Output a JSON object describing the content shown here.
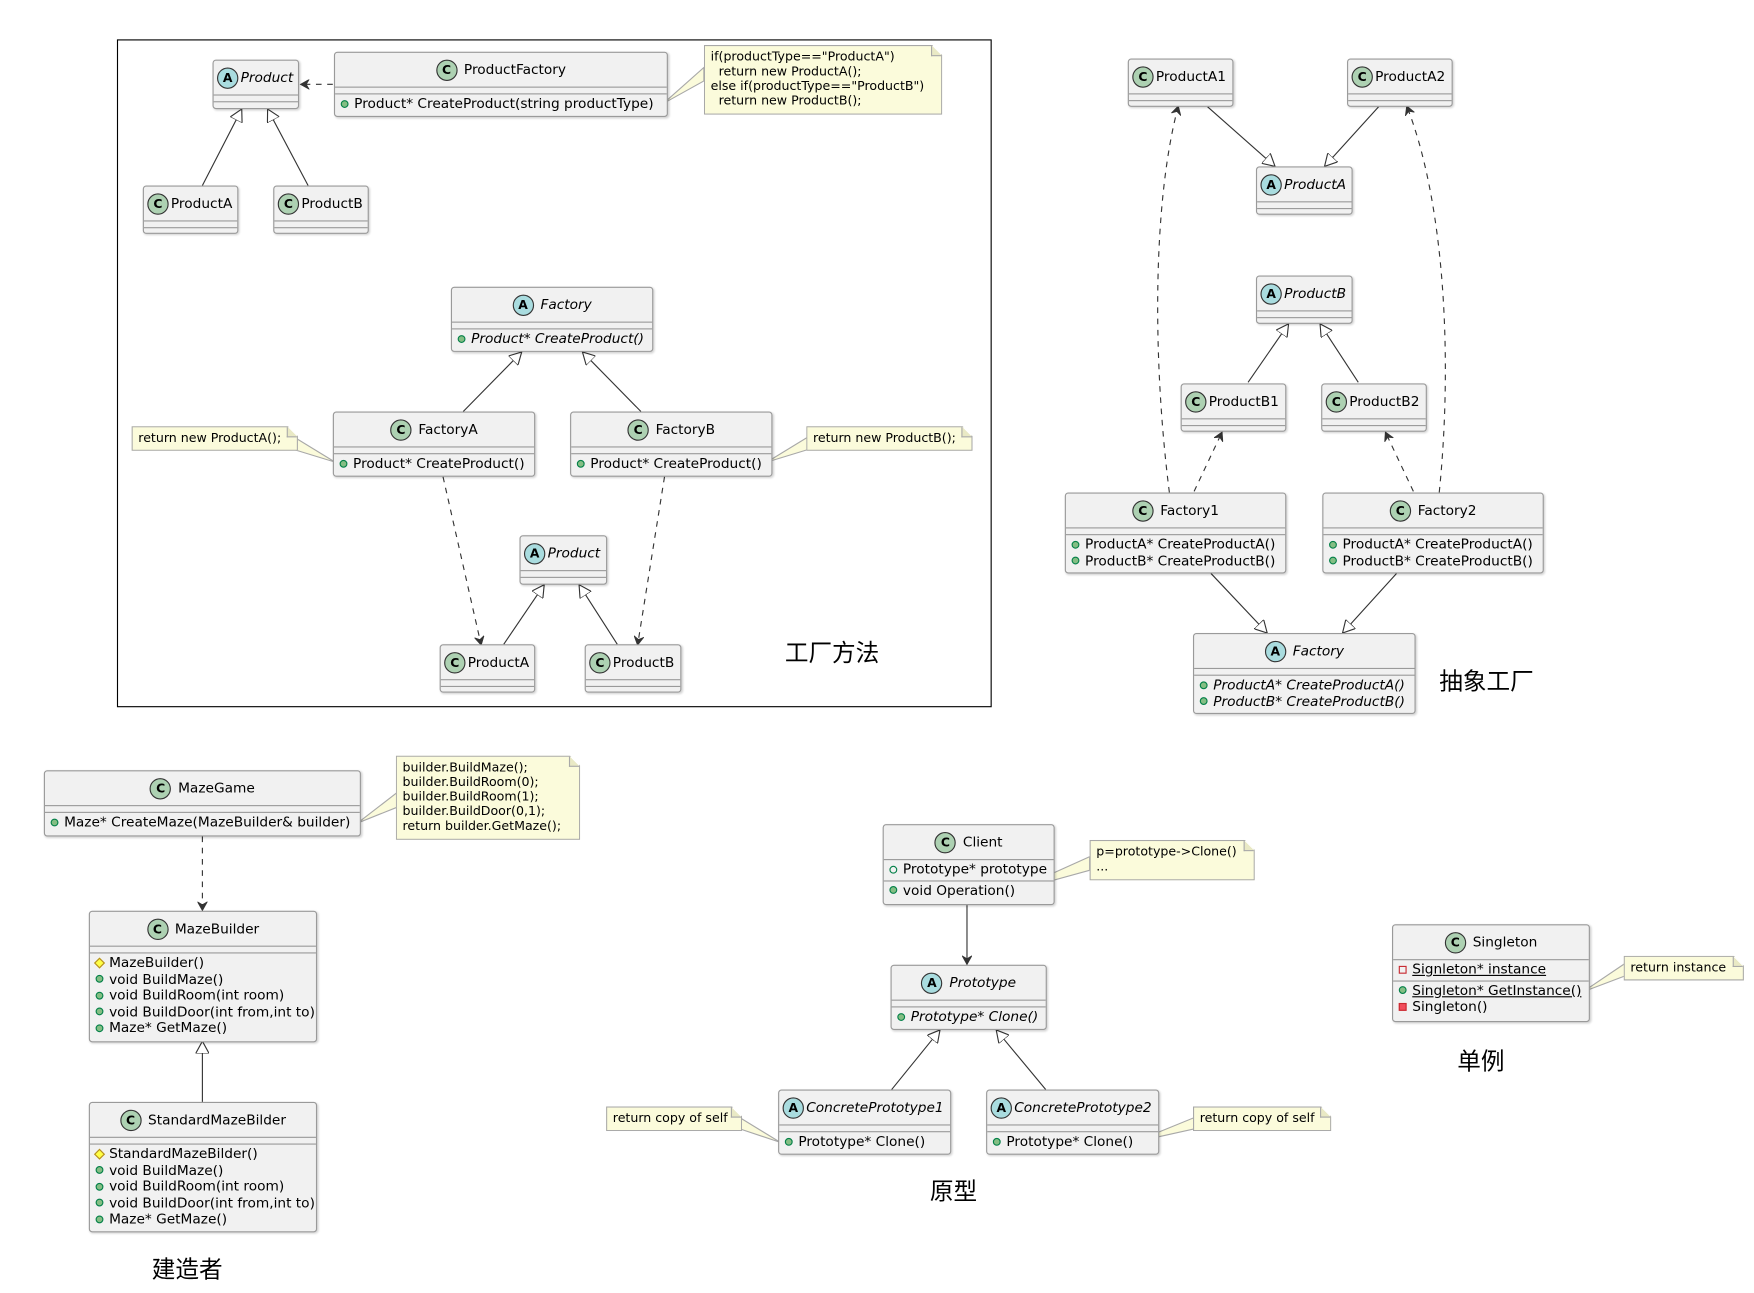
{
  "colors": {
    "class_fill": "#f1f1f1",
    "class_border": "#9a9a9a",
    "class_badge": "#add1b2",
    "abstract_badge": "#a9dcdf",
    "note_fill": "#fbfbdb"
  },
  "badges": {
    "class": "C",
    "abstract": "A"
  },
  "captions": {
    "factory_method": "工厂方法",
    "abstract_factory": "抽象工厂",
    "builder": "建造者",
    "prototype": "原型",
    "singleton": "单例"
  },
  "factory_method": {
    "simple": {
      "product": {
        "name": "Product"
      },
      "product_factory": {
        "name": "ProductFactory",
        "methods": [
          "Product* CreateProduct(string productType)"
        ]
      },
      "product_a": {
        "name": "ProductA"
      },
      "product_b": {
        "name": "ProductB"
      },
      "note": "if(productType==\"ProductA\")\n  return new ProductA();\nelse if(productType==\"ProductB\")\n  return new ProductB();"
    },
    "factory": {
      "name": "Factory",
      "methods": [
        "Product* CreateProduct()"
      ]
    },
    "factory_a": {
      "name": "FactoryA",
      "methods": [
        "Product* CreateProduct()"
      ],
      "note": "return new ProductA();"
    },
    "factory_b": {
      "name": "FactoryB",
      "methods": [
        "Product* CreateProduct()"
      ],
      "note": "return new ProductB();"
    },
    "product": {
      "name": "Product"
    },
    "product_a": {
      "name": "ProductA"
    },
    "product_b": {
      "name": "ProductB"
    }
  },
  "abstract_factory": {
    "product_a1": {
      "name": "ProductA1"
    },
    "product_a2": {
      "name": "ProductA2"
    },
    "product_a": {
      "name": "ProductA"
    },
    "product_b": {
      "name": "ProductB"
    },
    "product_b1": {
      "name": "ProductB1"
    },
    "product_b2": {
      "name": "ProductB2"
    },
    "factory1": {
      "name": "Factory1",
      "methods": [
        "ProductA* CreateProductA()",
        "ProductB* CreateProductB()"
      ]
    },
    "factory2": {
      "name": "Factory2",
      "methods": [
        "ProductA* CreateProductA()",
        "ProductB* CreateProductB()"
      ]
    },
    "factory": {
      "name": "Factory",
      "methods": [
        "ProductA* CreateProductA()",
        "ProductB* CreateProductB()"
      ]
    }
  },
  "builder": {
    "maze_game": {
      "name": "MazeGame",
      "methods": [
        "Maze* CreateMaze(MazeBuilder& builder)"
      ]
    },
    "note": "builder.BuildMaze();\nbuilder.BuildRoom(0);\nbuilder.BuildRoom(1);\nbuilder.BuildDoor(0,1);\nreturn builder.GetMaze();",
    "maze_builder": {
      "name": "MazeBuilder",
      "methods": [
        "MazeBuilder()",
        "void BuildMaze()",
        "void BuildRoom(int room)",
        "void BuildDoor(int from,int to)",
        "Maze* GetMaze()"
      ]
    },
    "standard_builder": {
      "name": "StandardMazeBilder",
      "methods": [
        "StandardMazeBilder()",
        "void BuildMaze()",
        "void BuildRoom(int room)",
        "void BuildDoor(int from,int to)",
        "Maze* GetMaze()"
      ]
    }
  },
  "prototype": {
    "client": {
      "name": "Client",
      "fields": [
        "Prototype* prototype"
      ],
      "methods": [
        "void Operation()"
      ]
    },
    "client_note": "p=prototype->Clone()\n...",
    "prototype": {
      "name": "Prototype",
      "methods": [
        "Prototype* Clone()"
      ]
    },
    "concrete1": {
      "name": "ConcretePrototype1",
      "methods": [
        "Prototype* Clone()"
      ],
      "note": "return copy of self"
    },
    "concrete2": {
      "name": "ConcretePrototype2",
      "methods": [
        "Prototype* Clone()"
      ],
      "note": "return copy of self"
    }
  },
  "singleton": {
    "singleton": {
      "name": "Singleton",
      "fields": [
        "Signleton* instance"
      ],
      "methods": [
        "Singleton* GetInstance()",
        "Singleton()"
      ]
    },
    "note": "return instance"
  }
}
